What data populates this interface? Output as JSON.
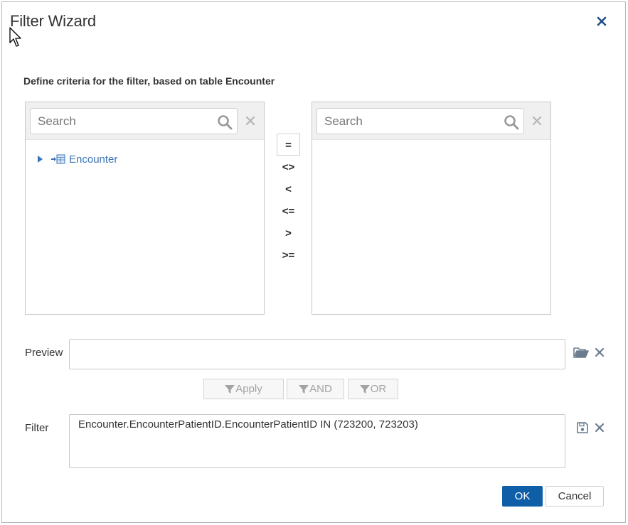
{
  "dialog": {
    "title": "Filter Wizard",
    "subtitle": "Define criteria for the filter, based on table Encounter"
  },
  "left_panel": {
    "search_placeholder": "Search",
    "tree": [
      {
        "label": "Encounter",
        "icon": "table-link-icon",
        "expanded": false
      }
    ]
  },
  "right_panel": {
    "search_placeholder": "Search"
  },
  "operators": [
    "=",
    "<>",
    "<",
    "<=",
    ">",
    ">="
  ],
  "preview": {
    "label": "Preview",
    "value": ""
  },
  "filter_buttons": {
    "apply": "Apply",
    "and": "AND",
    "or": "OR"
  },
  "filter": {
    "label": "Filter",
    "value": "Encounter.EncounterPatientID.EncounterPatientID IN (723200, 723203)"
  },
  "footer": {
    "ok": "OK",
    "cancel": "Cancel"
  },
  "colors": {
    "primary": "#0e5fa8",
    "link": "#3a74b8",
    "close": "#1d4f86",
    "icon_gray": "#9a9a9a"
  }
}
